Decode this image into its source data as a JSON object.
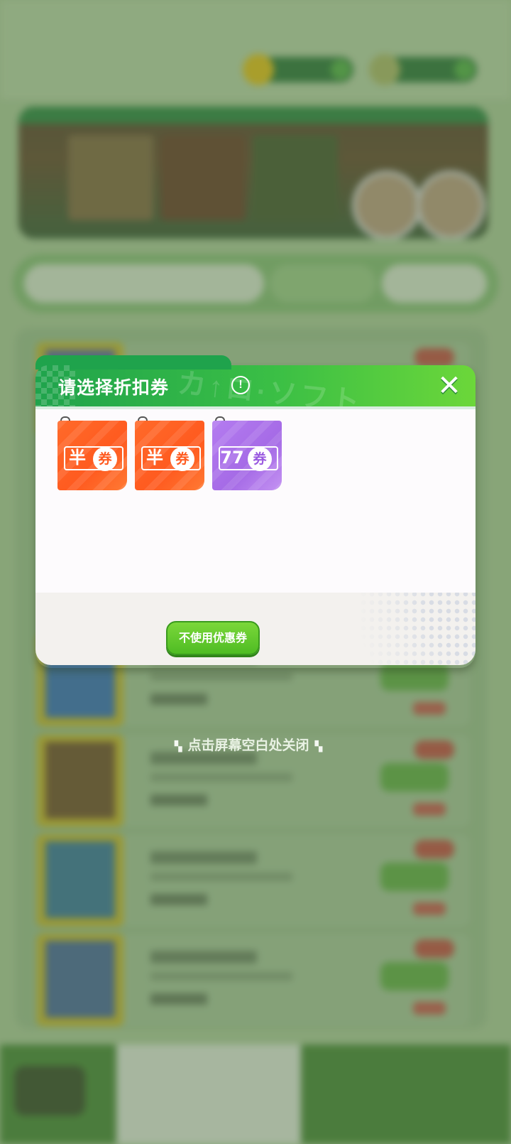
{
  "dialog": {
    "title": "请选择折扣券",
    "watermark": "カ↑ロ·ソフト",
    "coupons": [
      {
        "value": "半",
        "unit": "券",
        "color": "orange",
        "locked": true
      },
      {
        "value": "半",
        "unit": "券",
        "color": "orange",
        "locked": true
      },
      {
        "value": "77",
        "unit": "券",
        "color": "purple",
        "locked": true
      }
    ],
    "no_coupon_button": "不使用优惠券"
  },
  "close_hint": "点击屏幕空白处关闭",
  "icons": {
    "info": "!",
    "close": "✕",
    "hint_deco": "▚"
  },
  "colors": {
    "header_green": "#1fa34c",
    "button_green": "#4fbc23",
    "coupon_orange": "#ff5a1f",
    "coupon_purple": "#a56ae6"
  }
}
